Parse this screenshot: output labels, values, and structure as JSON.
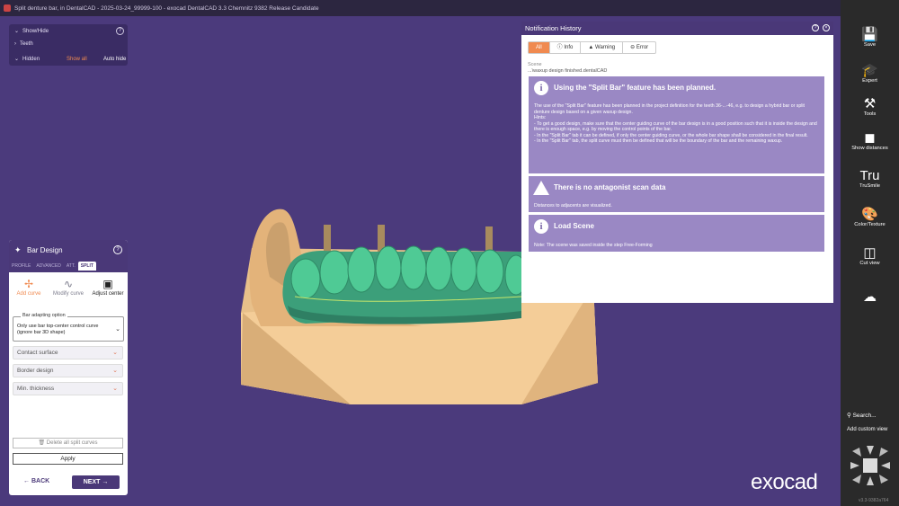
{
  "titlebar": {
    "title": "Split denture bar, in DentalCAD - 2025-03-24_99999-100 - exocad DentalCAD 3.3 Chemnitz 9382 Release Candidate"
  },
  "showhide": {
    "header": "Show/Hide",
    "teeth": "Teeth",
    "hidden": "Hidden",
    "show_all": "Show all",
    "auto_hide": "Auto hide",
    "help": "?"
  },
  "bar_design": {
    "title": "Bar Design",
    "help": "?",
    "tabs": [
      {
        "label": "PROFILE",
        "active": false
      },
      {
        "label": "ADVANCED",
        "active": false
      },
      {
        "label": "ATT.",
        "active": false
      },
      {
        "label": "SPLIT",
        "active": true
      }
    ],
    "tools": [
      {
        "label": "Add curve",
        "icon": "add-curve-icon"
      },
      {
        "label": "Modify curve",
        "icon": "modify-curve-icon"
      },
      {
        "label": "Adjust center",
        "icon": "adjust-center-icon"
      }
    ],
    "adapting_legend": "Bar adapting option",
    "adapting_value": "Only use bar top-center control curve (ignore bar 3D shape)",
    "dropdowns": [
      "Contact surface",
      "Border design",
      "Min. thickness"
    ],
    "delete_all": "Delete all split curves",
    "apply": "Apply",
    "back": "BACK",
    "next": "NEXT"
  },
  "notification": {
    "title": "Notification History",
    "filters": [
      {
        "label": "All",
        "active": true
      },
      {
        "label": "Info",
        "active": false
      },
      {
        "label": "Warning",
        "active": false
      },
      {
        "label": "Error",
        "active": false
      }
    ],
    "scene_label": "Scene",
    "scene_path": "...\\waxup design finished.dentalCAD",
    "messages": [
      {
        "type": "info",
        "title": "Using the \"Split Bar\" feature has been planned.",
        "body": "The use of the \"Split Bar\" feature has been planned in the project definition for the teeth 36-...-46, e.g. to design a hybrid bar or split denture design based on a given waxup design.\nHints:\n- To get a good design, make sure that the center guiding curve of the bar design is in a good position such that it is inside the design and there is enough space, e.g. by moving the control points of the bar.\n- In the \"Split Bar\" tab it can be defined, if only the center guiding curve, or the whole bar shape shall be considered in the final result.\n- In the \"Split Bar\" tab, the split curve must then be defined that will be the boundary of the bar and the remaining waxup."
      },
      {
        "type": "warning",
        "title": "There is no antagonist scan data",
        "body": "Distances to adjacents are visualized."
      },
      {
        "type": "info",
        "title": "Load Scene",
        "body": "Note: The scene was saved inside the step Free-Forming"
      }
    ]
  },
  "toolbar": {
    "buttons": [
      {
        "label": "Save",
        "icon": "save-icon"
      },
      {
        "label": "Expert",
        "icon": "graduation-cap-icon"
      },
      {
        "label": "Tools",
        "icon": "tools-icon"
      },
      {
        "label": "Show distances",
        "icon": "tooth-distance-icon"
      },
      {
        "label": "TruSmile",
        "icon": "trusmile-icon"
      },
      {
        "label": "Color/Texture",
        "icon": "palette-icon"
      },
      {
        "label": "Cut view",
        "icon": "cut-view-icon"
      },
      {
        "label": "",
        "icon": "cloud-icon"
      }
    ],
    "search": "Search...",
    "add_custom_view": "Add custom view",
    "version": "v3.3-9382a764"
  },
  "brand": "exocad"
}
